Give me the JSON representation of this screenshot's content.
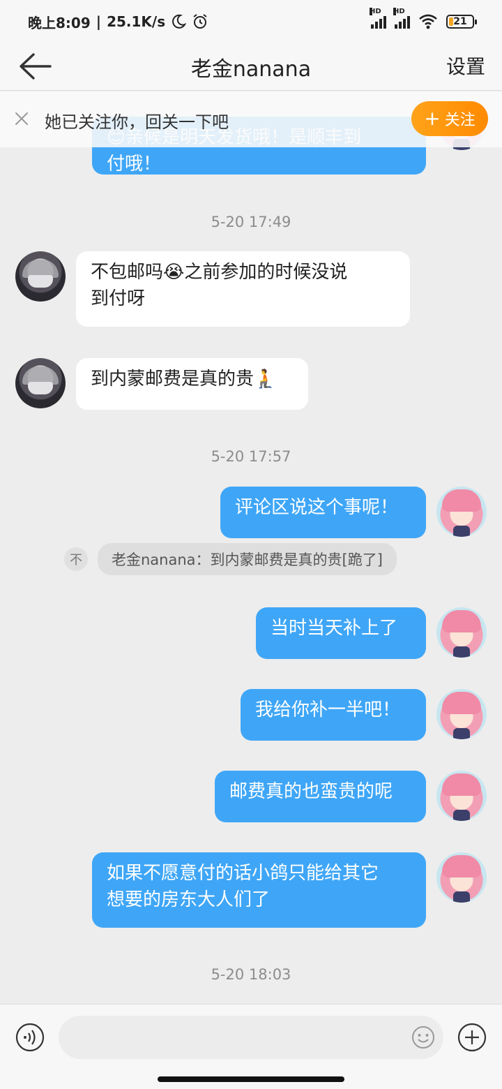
{
  "status_bar": {
    "time": "晚上8:09",
    "net_speed": "25.1K/s",
    "hd1": "HD",
    "hd2": "HD",
    "battery": "21"
  },
  "header": {
    "title": "老金nanana",
    "settings": "设置"
  },
  "follow_banner": {
    "text": "她已关注你，回关一下吧",
    "button": "关注",
    "button_plus": "+"
  },
  "messages": {
    "m0": "😊亲候是明天发货哦！是顺丰到\n付哦！",
    "t1": "5-20 17:49",
    "m1": "不包邮吗😭之前参加的时候没说\n到付呀",
    "m2": "到内蒙邮费是真的贵🧎",
    "t2": "5-20 17:57",
    "m3": "评论区说这个事呢！",
    "quote_icon": "不",
    "quote": "老金nanana：到内蒙邮费是真的贵[跪了]",
    "m4": "当时当天补上了",
    "m5": "我给你补一半吧！",
    "m6": "邮费真的也蛮贵的呢",
    "m7": "如果不愿意付的话小鸽只能给其它\n想要的房东大人们了",
    "t3": "5-20 18:03"
  },
  "input": {
    "placeholder": ""
  },
  "icons": {
    "back": "back-arrow-icon",
    "close": "close-icon",
    "voice": "voice-icon",
    "emoji": "emoji-icon",
    "plus": "plus-icon"
  },
  "colors": {
    "outgoing_bubble": "#3fa6f7",
    "follow_button": "#ff8a00",
    "background": "#ededed"
  }
}
